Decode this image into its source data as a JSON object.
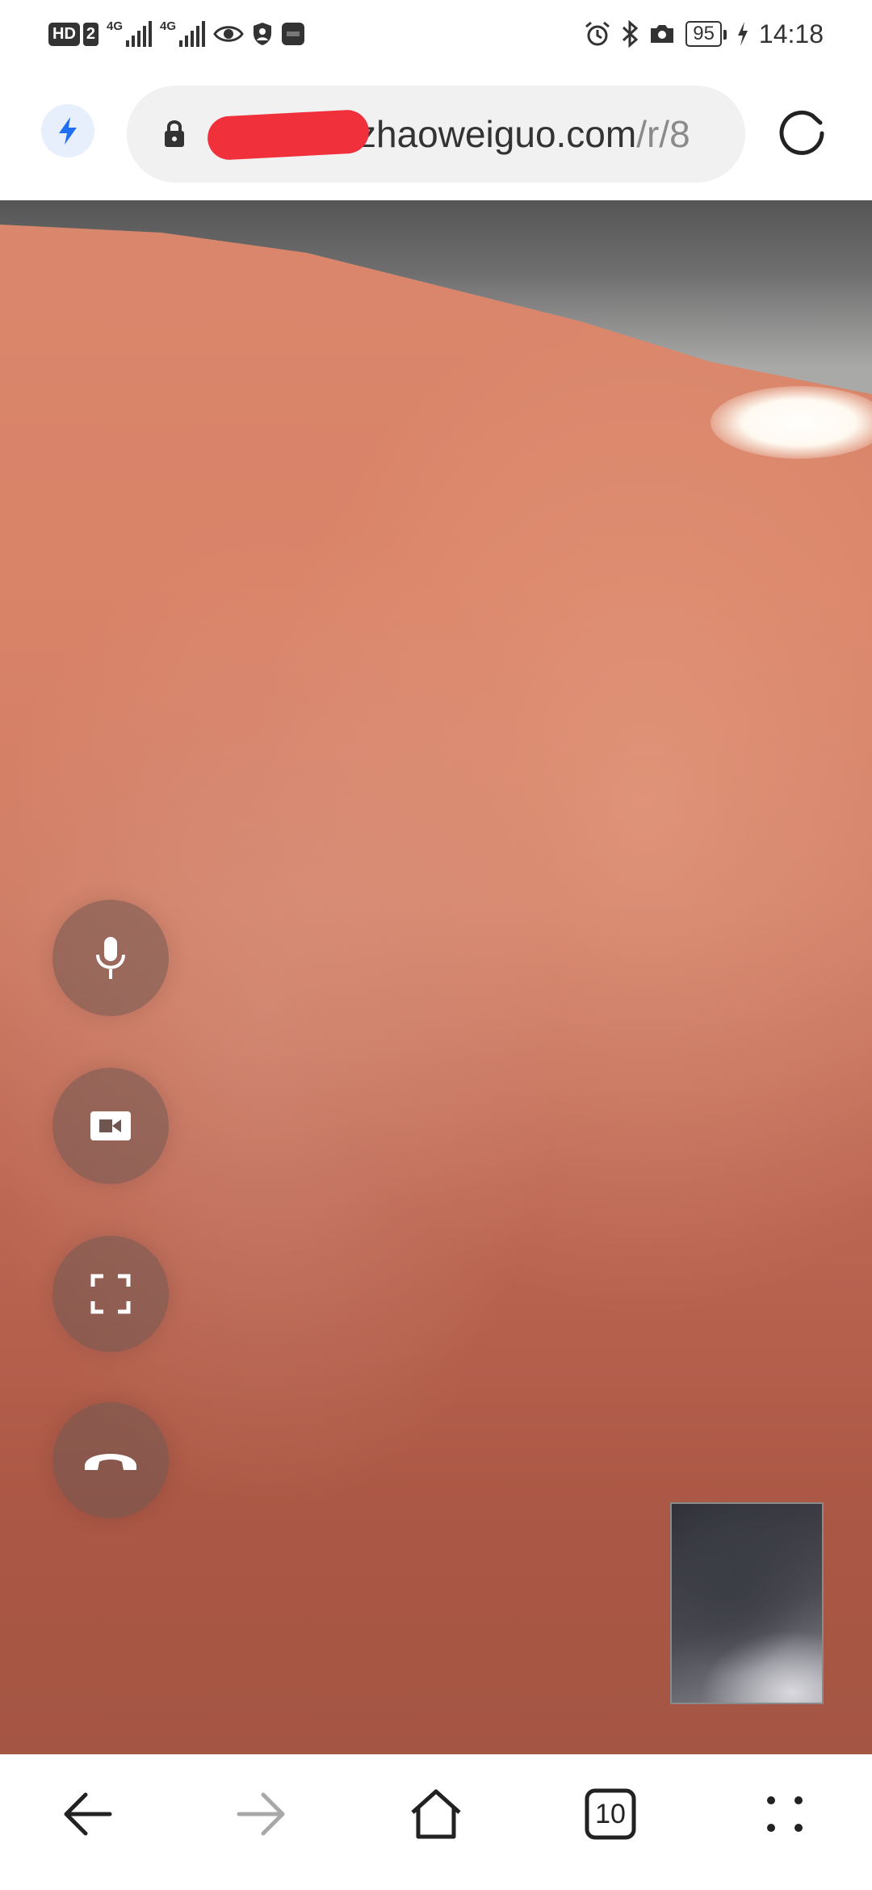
{
  "status_bar": {
    "hd_label": "HD",
    "sim_label": "2",
    "network_1": "4G",
    "network_2": "4G",
    "battery_level": "95",
    "time": "14:18",
    "left_icons": [
      "eye-icon",
      "shield-icon",
      "huawei-app-icon"
    ],
    "right_icons": [
      "alarm-icon",
      "bluetooth-icon",
      "camera-icon",
      "charging-icon"
    ]
  },
  "address_bar": {
    "url_visible": "zhaoweiguo.com",
    "url_path": "/r/8",
    "url_redacted": true,
    "icons": [
      "bolt-icon",
      "lock-icon",
      "reload-icon"
    ]
  },
  "video_call": {
    "controls": [
      {
        "name": "microphone",
        "icon": "microphone-icon"
      },
      {
        "name": "camera",
        "icon": "video-camera-icon"
      },
      {
        "name": "fullscreen",
        "icon": "fullscreen-icon"
      },
      {
        "name": "hang-up",
        "icon": "phone-hangup-icon"
      }
    ],
    "self_view": "local-preview"
  },
  "bottom_nav": {
    "tab_count": "10",
    "icons": [
      "back-arrow-icon",
      "forward-arrow-icon",
      "home-icon",
      "tabs-icon",
      "menu-icon"
    ]
  },
  "colors": {
    "accent": "#1f6ff0",
    "redaction": "#f0313b",
    "icon": "#333333",
    "disabled": "#a8a8a8"
  }
}
